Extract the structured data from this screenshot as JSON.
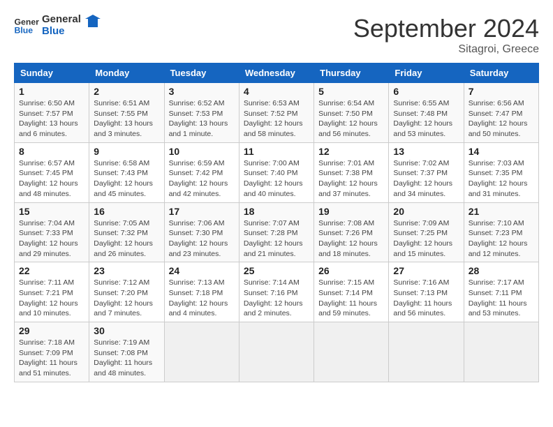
{
  "header": {
    "logo_general": "General",
    "logo_blue": "Blue",
    "month_year": "September 2024",
    "location": "Sitagroi, Greece"
  },
  "weekdays": [
    "Sunday",
    "Monday",
    "Tuesday",
    "Wednesday",
    "Thursday",
    "Friday",
    "Saturday"
  ],
  "weeks": [
    [
      {
        "day": "1",
        "info": "Sunrise: 6:50 AM\nSunset: 7:57 PM\nDaylight: 13 hours\nand 6 minutes."
      },
      {
        "day": "2",
        "info": "Sunrise: 6:51 AM\nSunset: 7:55 PM\nDaylight: 13 hours\nand 3 minutes."
      },
      {
        "day": "3",
        "info": "Sunrise: 6:52 AM\nSunset: 7:53 PM\nDaylight: 13 hours\nand 1 minute."
      },
      {
        "day": "4",
        "info": "Sunrise: 6:53 AM\nSunset: 7:52 PM\nDaylight: 12 hours\nand 58 minutes."
      },
      {
        "day": "5",
        "info": "Sunrise: 6:54 AM\nSunset: 7:50 PM\nDaylight: 12 hours\nand 56 minutes."
      },
      {
        "day": "6",
        "info": "Sunrise: 6:55 AM\nSunset: 7:48 PM\nDaylight: 12 hours\nand 53 minutes."
      },
      {
        "day": "7",
        "info": "Sunrise: 6:56 AM\nSunset: 7:47 PM\nDaylight: 12 hours\nand 50 minutes."
      }
    ],
    [
      {
        "day": "8",
        "info": "Sunrise: 6:57 AM\nSunset: 7:45 PM\nDaylight: 12 hours\nand 48 minutes."
      },
      {
        "day": "9",
        "info": "Sunrise: 6:58 AM\nSunset: 7:43 PM\nDaylight: 12 hours\nand 45 minutes."
      },
      {
        "day": "10",
        "info": "Sunrise: 6:59 AM\nSunset: 7:42 PM\nDaylight: 12 hours\nand 42 minutes."
      },
      {
        "day": "11",
        "info": "Sunrise: 7:00 AM\nSunset: 7:40 PM\nDaylight: 12 hours\nand 40 minutes."
      },
      {
        "day": "12",
        "info": "Sunrise: 7:01 AM\nSunset: 7:38 PM\nDaylight: 12 hours\nand 37 minutes."
      },
      {
        "day": "13",
        "info": "Sunrise: 7:02 AM\nSunset: 7:37 PM\nDaylight: 12 hours\nand 34 minutes."
      },
      {
        "day": "14",
        "info": "Sunrise: 7:03 AM\nSunset: 7:35 PM\nDaylight: 12 hours\nand 31 minutes."
      }
    ],
    [
      {
        "day": "15",
        "info": "Sunrise: 7:04 AM\nSunset: 7:33 PM\nDaylight: 12 hours\nand 29 minutes."
      },
      {
        "day": "16",
        "info": "Sunrise: 7:05 AM\nSunset: 7:32 PM\nDaylight: 12 hours\nand 26 minutes."
      },
      {
        "day": "17",
        "info": "Sunrise: 7:06 AM\nSunset: 7:30 PM\nDaylight: 12 hours\nand 23 minutes."
      },
      {
        "day": "18",
        "info": "Sunrise: 7:07 AM\nSunset: 7:28 PM\nDaylight: 12 hours\nand 21 minutes."
      },
      {
        "day": "19",
        "info": "Sunrise: 7:08 AM\nSunset: 7:26 PM\nDaylight: 12 hours\nand 18 minutes."
      },
      {
        "day": "20",
        "info": "Sunrise: 7:09 AM\nSunset: 7:25 PM\nDaylight: 12 hours\nand 15 minutes."
      },
      {
        "day": "21",
        "info": "Sunrise: 7:10 AM\nSunset: 7:23 PM\nDaylight: 12 hours\nand 12 minutes."
      }
    ],
    [
      {
        "day": "22",
        "info": "Sunrise: 7:11 AM\nSunset: 7:21 PM\nDaylight: 12 hours\nand 10 minutes."
      },
      {
        "day": "23",
        "info": "Sunrise: 7:12 AM\nSunset: 7:20 PM\nDaylight: 12 hours\nand 7 minutes."
      },
      {
        "day": "24",
        "info": "Sunrise: 7:13 AM\nSunset: 7:18 PM\nDaylight: 12 hours\nand 4 minutes."
      },
      {
        "day": "25",
        "info": "Sunrise: 7:14 AM\nSunset: 7:16 PM\nDaylight: 12 hours\nand 2 minutes."
      },
      {
        "day": "26",
        "info": "Sunrise: 7:15 AM\nSunset: 7:14 PM\nDaylight: 11 hours\nand 59 minutes."
      },
      {
        "day": "27",
        "info": "Sunrise: 7:16 AM\nSunset: 7:13 PM\nDaylight: 11 hours\nand 56 minutes."
      },
      {
        "day": "28",
        "info": "Sunrise: 7:17 AM\nSunset: 7:11 PM\nDaylight: 11 hours\nand 53 minutes."
      }
    ],
    [
      {
        "day": "29",
        "info": "Sunrise: 7:18 AM\nSunset: 7:09 PM\nDaylight: 11 hours\nand 51 minutes."
      },
      {
        "day": "30",
        "info": "Sunrise: 7:19 AM\nSunset: 7:08 PM\nDaylight: 11 hours\nand 48 minutes."
      },
      {
        "day": "",
        "info": ""
      },
      {
        "day": "",
        "info": ""
      },
      {
        "day": "",
        "info": ""
      },
      {
        "day": "",
        "info": ""
      },
      {
        "day": "",
        "info": ""
      }
    ]
  ]
}
